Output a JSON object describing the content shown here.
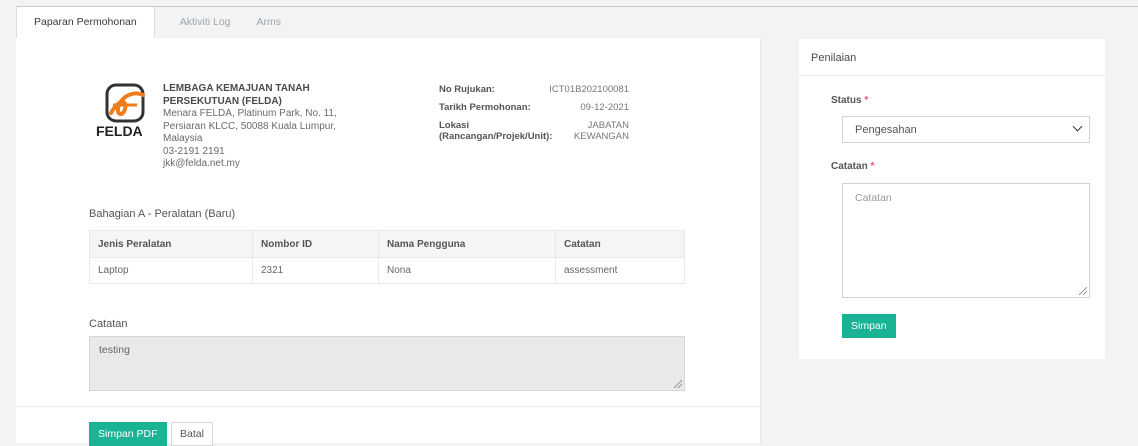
{
  "tabs": [
    {
      "label": "Paparan Permohonan"
    },
    {
      "label": "Aktiviti Log"
    },
    {
      "label": "Arms"
    }
  ],
  "org": {
    "logo_text": "FELDA",
    "name": "LEMBAGA KEMAJUAN TANAH PERSEKUTUAN (FELDA)",
    "address_line1": "Menara FELDA, Platinum Park, No. 11,",
    "address_line2": "Persiaran KLCC, 50088 Kuala Lumpur,",
    "address_line3": "Malaysia",
    "phone": "03-2191 2191",
    "email": "jkk@felda.net.my"
  },
  "meta": {
    "ref_label": "No Rujukan:",
    "ref_value": "ICT01B202100081",
    "date_label": "Tarikh Permohonan:",
    "date_value": "09-12-2021",
    "loc_label_1": "Lokasi",
    "loc_label_2": "(Rancangan/Projek/Unit):",
    "loc_value_1": "JABATAN",
    "loc_value_2": "KEWANGAN"
  },
  "section_a": {
    "title": "Bahagian A - Peralatan (Baru)",
    "columns": [
      "Jenis Peralatan",
      "Nombor ID",
      "Nama Pengguna",
      "Catatan"
    ],
    "rows": [
      [
        "Laptop",
        "2321",
        "Nona",
        "assessment"
      ]
    ]
  },
  "notes": {
    "label": "Catatan",
    "value": "testing"
  },
  "actions": {
    "pdf_label": "Simpan PDF",
    "cancel_label": "Batal"
  },
  "assessment": {
    "title": "Penilaian",
    "status_label": "Status",
    "required_mark": "*",
    "status_value": "Pengesahan",
    "notes_label": "Catatan",
    "notes_placeholder": "Catatan",
    "save_label": "Simpan"
  },
  "colors": {
    "primary": "#1ab394",
    "required": "#ed5565",
    "logo_orange": "#f07c1a"
  }
}
